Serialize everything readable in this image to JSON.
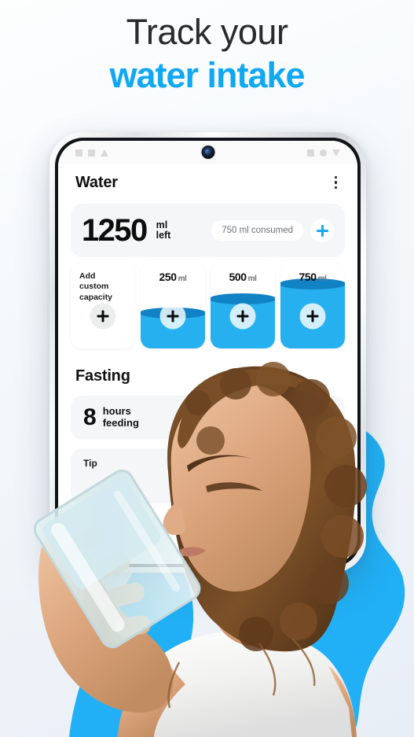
{
  "headline": {
    "line1": "Track your",
    "line2": "water intake"
  },
  "theme": {
    "accent_blue": "#11a8f2",
    "water_blue": "#27b0ef",
    "water_blue_dark": "#1183c4",
    "background_top": "#fdfefe",
    "background_bottom": "#e8eef6",
    "text_dark": "#111111",
    "text_muted": "#6d7075",
    "card_grey": "#f5f6f7"
  },
  "phone": {
    "status_bar": {
      "left_icons": [
        "square-icon",
        "square-icon",
        "triangle-up-icon"
      ],
      "right_icons": [
        "square-icon",
        "circle-icon",
        "triangle-down-icon"
      ],
      "camera": "front-camera-punch-hole"
    },
    "app_header": {
      "title": "Water",
      "menu_icon": "kebab-menu-icon"
    },
    "water_summary": {
      "amount": "1250",
      "unit_line1": "ml",
      "unit_line2": "left",
      "consumed_label": "750 ml consumed",
      "add_icon": "plus-icon"
    },
    "capacity_tiles": [
      {
        "type": "custom",
        "label": "Add\ncustom\ncapacity",
        "label_line1": "Add",
        "label_line2": "custom",
        "label_line3": "capacity",
        "fill_percent": 0,
        "icon": "plus-icon"
      },
      {
        "type": "preset",
        "amount": "250",
        "unit": "ml",
        "fill_percent": 42,
        "icon": "plus-icon"
      },
      {
        "type": "preset",
        "amount": "500",
        "unit": "ml",
        "fill_percent": 58,
        "icon": "plus-icon"
      },
      {
        "type": "preset",
        "amount": "750",
        "unit": "ml",
        "fill_percent": 76,
        "icon": "plus-icon"
      }
    ],
    "fasting": {
      "title": "Fasting",
      "hours_number": "8",
      "hours_line1": "hours",
      "hours_line2": "feeding",
      "tip_label": "Tip"
    }
  },
  "photo": {
    "subject": "woman drinking water from a glass",
    "shirt_color": "#f2f2f0",
    "hair_color": "#6c4526",
    "skin_color": "#d9a881"
  }
}
